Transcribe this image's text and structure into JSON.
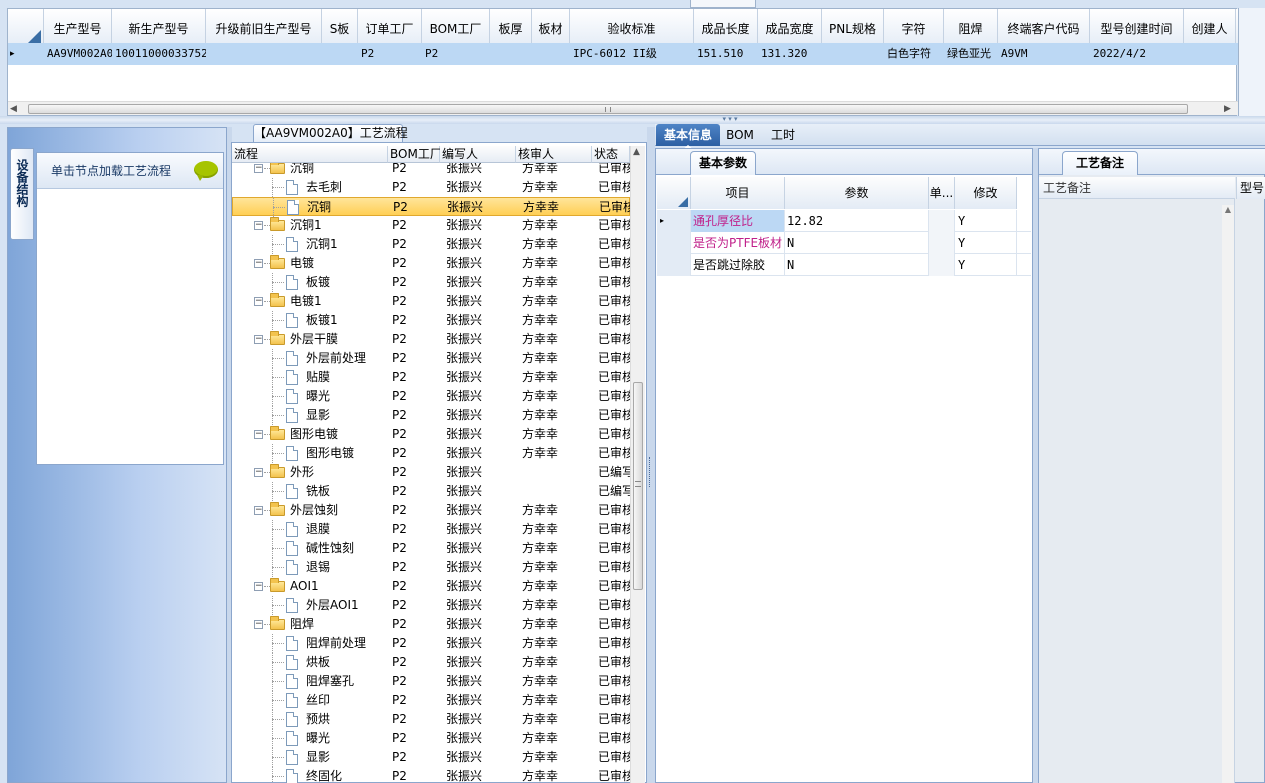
{
  "top_grid": {
    "headers": [
      "生产型号",
      "新生产型号",
      "升级前旧生产型号",
      "S板",
      "订单工厂",
      "BOM工厂",
      "板厚",
      "板材",
      "验收标准",
      "成品长度",
      "成品宽度",
      "PNL规格",
      "字符",
      "阻焊",
      "终端客户代码",
      "型号创建时间",
      "创建人"
    ],
    "row": [
      "AA9VM002A0",
      "10011000033752",
      "",
      "",
      "P2",
      "P2",
      "",
      "",
      "IPC-6012 II级",
      "151.510",
      "131.320",
      "",
      "白色字符",
      "绿色亚光",
      "A9VM",
      "2022/4/2",
      ""
    ],
    "row_indicator": "▸"
  },
  "left_panel": {
    "vertical_tab": "设备结构",
    "node_hint": "单击节点加载工艺流程"
  },
  "tree": {
    "title": "【AA9VM002A0】工艺流程",
    "headers": [
      "流程",
      "BOM工厂",
      "编写人",
      "核审人",
      "状态"
    ],
    "rows": [
      {
        "name": "沉铜",
        "level": 0,
        "factory": "P2",
        "writer": "张振兴",
        "reviewer": "方幸幸",
        "status": "已审核"
      },
      {
        "name": "去毛刺",
        "level": 1,
        "factory": "P2",
        "writer": "张振兴",
        "reviewer": "方幸幸",
        "status": "已审核"
      },
      {
        "name": "沉铜",
        "level": 1,
        "factory": "P2",
        "writer": "张振兴",
        "reviewer": "方幸幸",
        "status": "已审核",
        "selected": true
      },
      {
        "name": "沉铜1",
        "level": 0,
        "factory": "P2",
        "writer": "张振兴",
        "reviewer": "方幸幸",
        "status": "已审核"
      },
      {
        "name": "沉铜1",
        "level": 1,
        "factory": "P2",
        "writer": "张振兴",
        "reviewer": "方幸幸",
        "status": "已审核"
      },
      {
        "name": "电镀",
        "level": 0,
        "factory": "P2",
        "writer": "张振兴",
        "reviewer": "方幸幸",
        "status": "已审核"
      },
      {
        "name": "板镀",
        "level": 1,
        "factory": "P2",
        "writer": "张振兴",
        "reviewer": "方幸幸",
        "status": "已审核"
      },
      {
        "name": "电镀1",
        "level": 0,
        "factory": "P2",
        "writer": "张振兴",
        "reviewer": "方幸幸",
        "status": "已审核"
      },
      {
        "name": "板镀1",
        "level": 1,
        "factory": "P2",
        "writer": "张振兴",
        "reviewer": "方幸幸",
        "status": "已审核"
      },
      {
        "name": "外层干膜",
        "level": 0,
        "factory": "P2",
        "writer": "张振兴",
        "reviewer": "方幸幸",
        "status": "已审核"
      },
      {
        "name": "外层前处理",
        "level": 1,
        "factory": "P2",
        "writer": "张振兴",
        "reviewer": "方幸幸",
        "status": "已审核"
      },
      {
        "name": "贴膜",
        "level": 1,
        "factory": "P2",
        "writer": "张振兴",
        "reviewer": "方幸幸",
        "status": "已审核"
      },
      {
        "name": "曝光",
        "level": 1,
        "factory": "P2",
        "writer": "张振兴",
        "reviewer": "方幸幸",
        "status": "已审核"
      },
      {
        "name": "显影",
        "level": 1,
        "factory": "P2",
        "writer": "张振兴",
        "reviewer": "方幸幸",
        "status": "已审核"
      },
      {
        "name": "图形电镀",
        "level": 0,
        "factory": "P2",
        "writer": "张振兴",
        "reviewer": "方幸幸",
        "status": "已审核"
      },
      {
        "name": "图形电镀",
        "level": 1,
        "factory": "P2",
        "writer": "张振兴",
        "reviewer": "方幸幸",
        "status": "已审核"
      },
      {
        "name": "外形",
        "level": 0,
        "factory": "P2",
        "writer": "张振兴",
        "reviewer": "",
        "status": "已编写"
      },
      {
        "name": "铣板",
        "level": 1,
        "factory": "P2",
        "writer": "张振兴",
        "reviewer": "",
        "status": "已编写"
      },
      {
        "name": "外层蚀刻",
        "level": 0,
        "factory": "P2",
        "writer": "张振兴",
        "reviewer": "方幸幸",
        "status": "已审核"
      },
      {
        "name": "退膜",
        "level": 1,
        "factory": "P2",
        "writer": "张振兴",
        "reviewer": "方幸幸",
        "status": "已审核"
      },
      {
        "name": "碱性蚀刻",
        "level": 1,
        "factory": "P2",
        "writer": "张振兴",
        "reviewer": "方幸幸",
        "status": "已审核"
      },
      {
        "name": "退锡",
        "level": 1,
        "factory": "P2",
        "writer": "张振兴",
        "reviewer": "方幸幸",
        "status": "已审核"
      },
      {
        "name": "AOI1",
        "level": 0,
        "factory": "P2",
        "writer": "张振兴",
        "reviewer": "方幸幸",
        "status": "已审核"
      },
      {
        "name": "外层AOI1",
        "level": 1,
        "factory": "P2",
        "writer": "张振兴",
        "reviewer": "方幸幸",
        "status": "已审核"
      },
      {
        "name": "阻焊",
        "level": 0,
        "factory": "P2",
        "writer": "张振兴",
        "reviewer": "方幸幸",
        "status": "已审核"
      },
      {
        "name": "阻焊前处理",
        "level": 1,
        "factory": "P2",
        "writer": "张振兴",
        "reviewer": "方幸幸",
        "status": "已审核"
      },
      {
        "name": "烘板",
        "level": 1,
        "factory": "P2",
        "writer": "张振兴",
        "reviewer": "方幸幸",
        "status": "已审核"
      },
      {
        "name": "阻焊塞孔",
        "level": 1,
        "factory": "P2",
        "writer": "张振兴",
        "reviewer": "方幸幸",
        "status": "已审核"
      },
      {
        "name": "丝印",
        "level": 1,
        "factory": "P2",
        "writer": "张振兴",
        "reviewer": "方幸幸",
        "status": "已审核"
      },
      {
        "name": "预烘",
        "level": 1,
        "factory": "P2",
        "writer": "张振兴",
        "reviewer": "方幸幸",
        "status": "已审核"
      },
      {
        "name": "曝光",
        "level": 1,
        "factory": "P2",
        "writer": "张振兴",
        "reviewer": "方幸幸",
        "status": "已审核"
      },
      {
        "name": "显影",
        "level": 1,
        "factory": "P2",
        "writer": "张振兴",
        "reviewer": "方幸幸",
        "status": "已审核"
      },
      {
        "name": "终固化",
        "level": 1,
        "factory": "P2",
        "writer": "张振兴",
        "reviewer": "方幸幸",
        "status": "已审核"
      }
    ]
  },
  "right_tabs": [
    "基本信息",
    "BOM",
    "工时"
  ],
  "params": {
    "tab": "基本参数",
    "headers": [
      "项目",
      "参数",
      "单...",
      "修改"
    ],
    "rows": [
      {
        "item": "通孔厚径比",
        "value": "12.82",
        "unit": "",
        "modified": "Y"
      },
      {
        "item": "是否为PTFE板材",
        "value": "N",
        "unit": "",
        "modified": "Y"
      },
      {
        "item": "是否跳过除胶",
        "value": "N",
        "unit": "",
        "modified": "Y"
      }
    ]
  },
  "notes": {
    "tab": "工艺备注",
    "header": "工艺备注",
    "header2": "型号"
  },
  "colors": {
    "accent": "#3a6ea5",
    "selection": "#ffd667",
    "grid_row": "#bcd8f4",
    "pink_text": "#c0208a"
  }
}
